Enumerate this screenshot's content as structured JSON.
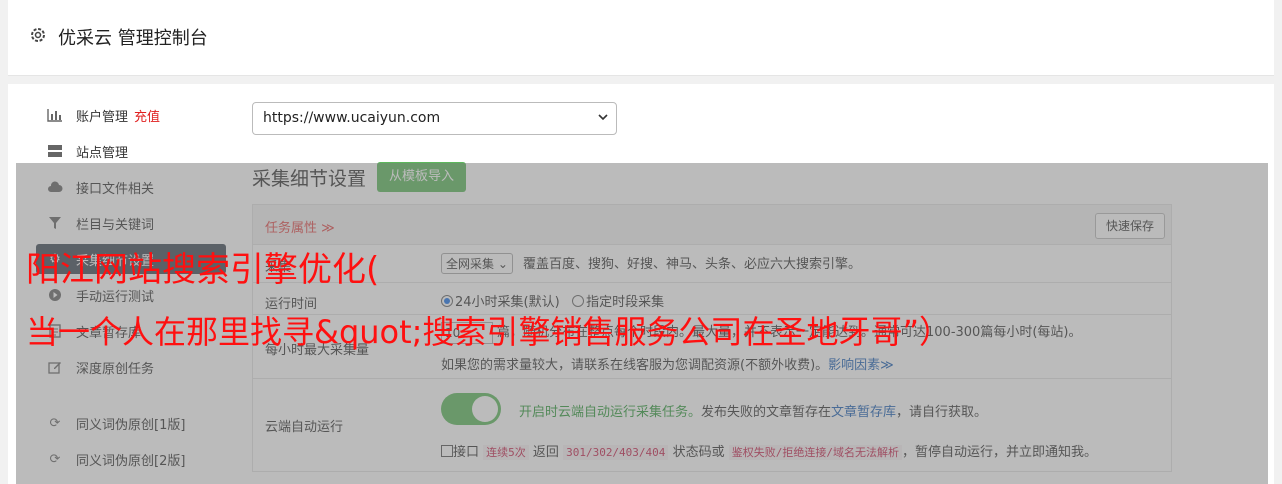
{
  "header": {
    "title": "优采云 管理控制台",
    "icon": "gear-icon"
  },
  "sidebar": {
    "items": [
      {
        "label": "账户管理",
        "badge": "充值",
        "icon": "bar-chart-icon"
      },
      {
        "label": "站点管理",
        "icon": "server-icon"
      },
      {
        "label": "接口文件相关",
        "icon": "cloud-upload-icon"
      },
      {
        "label": "栏目与关键词",
        "icon": "filter-icon"
      },
      {
        "label": "采集细节设置",
        "icon": "gear-icon",
        "active": true
      },
      {
        "label": "手动运行测试",
        "icon": "play-icon"
      },
      {
        "label": "文章暂存库",
        "icon": "document-icon"
      },
      {
        "label": "深度原创任务",
        "icon": "edit-icon"
      },
      {
        "label": "同义词伪原创[1版]",
        "icon": "refresh-icon"
      },
      {
        "label": "同义词伪原创[2版]",
        "icon": "refresh-icon"
      }
    ]
  },
  "site_select": {
    "value": "https://www.ucaiyun.com"
  },
  "section": {
    "title": "采集细节设置",
    "import_button": "从模板导入"
  },
  "table": {
    "header_prop": "任务属性 ≫",
    "quick_save": "快速保存",
    "row1": {
      "label": "采集",
      "select": "全网采集",
      "desc": "覆盖百度、搜狗、好搜、神马、头条、必应六大搜索引擎。"
    },
    "row2": {
      "label": "运行时间",
      "opt1": "24小时采集(默认)",
      "opt2": "指定时段采集"
    },
    "row3": {
      "label": "每小时最大采集量",
      "num": "10",
      "line1": "篇，随机分布在整点每个时段内。最大量，并不表示一定能达到。通常可达100-300篇每小时(每站)。",
      "line2a": "如果您的需求量较大，请联系在线客服为您调配资源(不额外收费)。",
      "line2b": "影响因素≫"
    },
    "row4": {
      "label": "云端自动运行",
      "line1a": "开启时云端自动运行采集任务。",
      "line1b": "发布失败的文章暂存在",
      "line1c": "文章暂存库",
      "line1d": "，请自行获取。",
      "l2a": "接口",
      "l2b": "连续5次",
      "l2c": "返回",
      "l2d": "301/302/403/404",
      "l2e": "状态码或",
      "l2f": "鉴权失败/拒绝连接/域名无法解析",
      "l2g": "，暂停自动运行，并立即通知我。"
    }
  },
  "watermark": {
    "line1": "阳江网站搜索引擎优化(",
    "line2": "当一个人在那里找寻&quot;搜索引擎销售服务公司在圣地牙哥”）"
  },
  "colors": {
    "accent_green": "#5cb85c",
    "active_nav": "#3f4a56",
    "watermark": "#ff1010"
  }
}
